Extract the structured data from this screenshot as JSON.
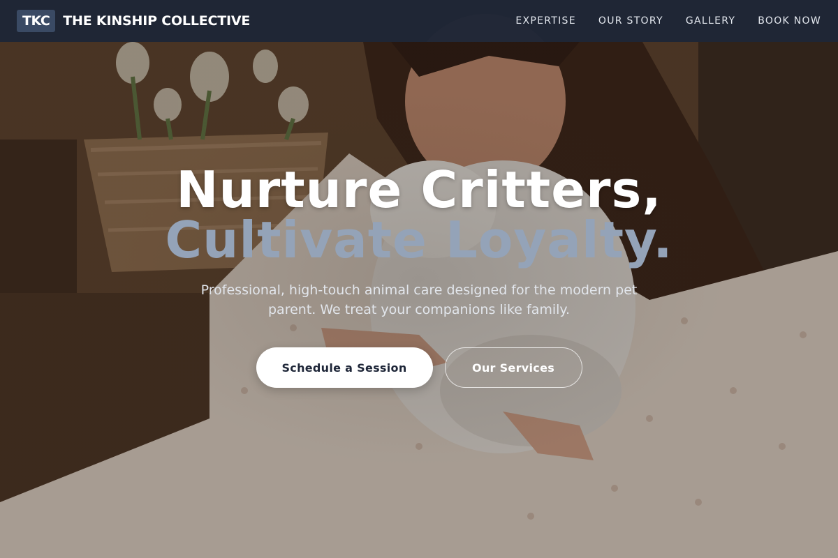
{
  "brand": {
    "badge": "TKC",
    "name": "THE KINSHIP COLLECTIVE"
  },
  "nav": {
    "items": [
      {
        "label": "EXPERTISE"
      },
      {
        "label": "OUR STORY"
      },
      {
        "label": "GALLERY"
      },
      {
        "label": "BOOK NOW"
      }
    ]
  },
  "hero": {
    "headline_line1": "Nurture Critters,",
    "headline_line2": "Cultivate Loyalty.",
    "subtitle": "Professional, high-touch animal care designed for the modern pet parent. We treat your companions like family.",
    "primary_cta": "Schedule a Session",
    "secondary_cta": "Our Services",
    "background_image": "woman-holding-rabbit-photo"
  },
  "colors": {
    "navbar": "#1c2536",
    "accent_muted": "#94a3b8",
    "button_text": "#1e2638"
  }
}
